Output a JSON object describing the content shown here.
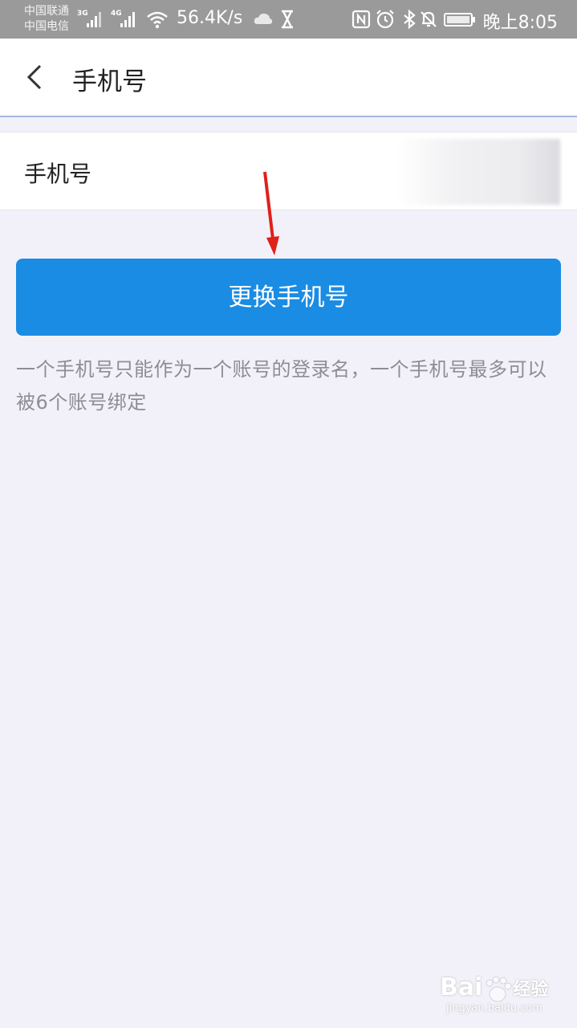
{
  "status_bar": {
    "carrier_1": "中国联通",
    "carrier_2": "中国电信",
    "sim1_network": "3G",
    "sim2_network": "4G",
    "net_speed": "56.4K/s",
    "time": "晚上8:05",
    "icons": [
      "signal-icon",
      "signal-icon",
      "wifi-icon",
      "cloud-icon",
      "hourglass-icon",
      "nfc-icon",
      "alarm-icon",
      "bluetooth-icon",
      "mute-icon",
      "battery-icon"
    ]
  },
  "header": {
    "back_icon": "chevron-left-icon",
    "title": "手机号"
  },
  "phone_row": {
    "label": "手机号"
  },
  "change_button": {
    "label": "更换手机号",
    "color": "#1a8ce3"
  },
  "note": {
    "text": "一个手机号只能作为一个账号的登录名，一个手机号最多可以被6个账号绑定"
  },
  "annotation": {
    "icon": "arrow-down-icon",
    "color": "#e0201a"
  },
  "watermark": {
    "brand": "Bai",
    "brand_cn": "经验",
    "domain": "jingyan.baidu.com"
  }
}
